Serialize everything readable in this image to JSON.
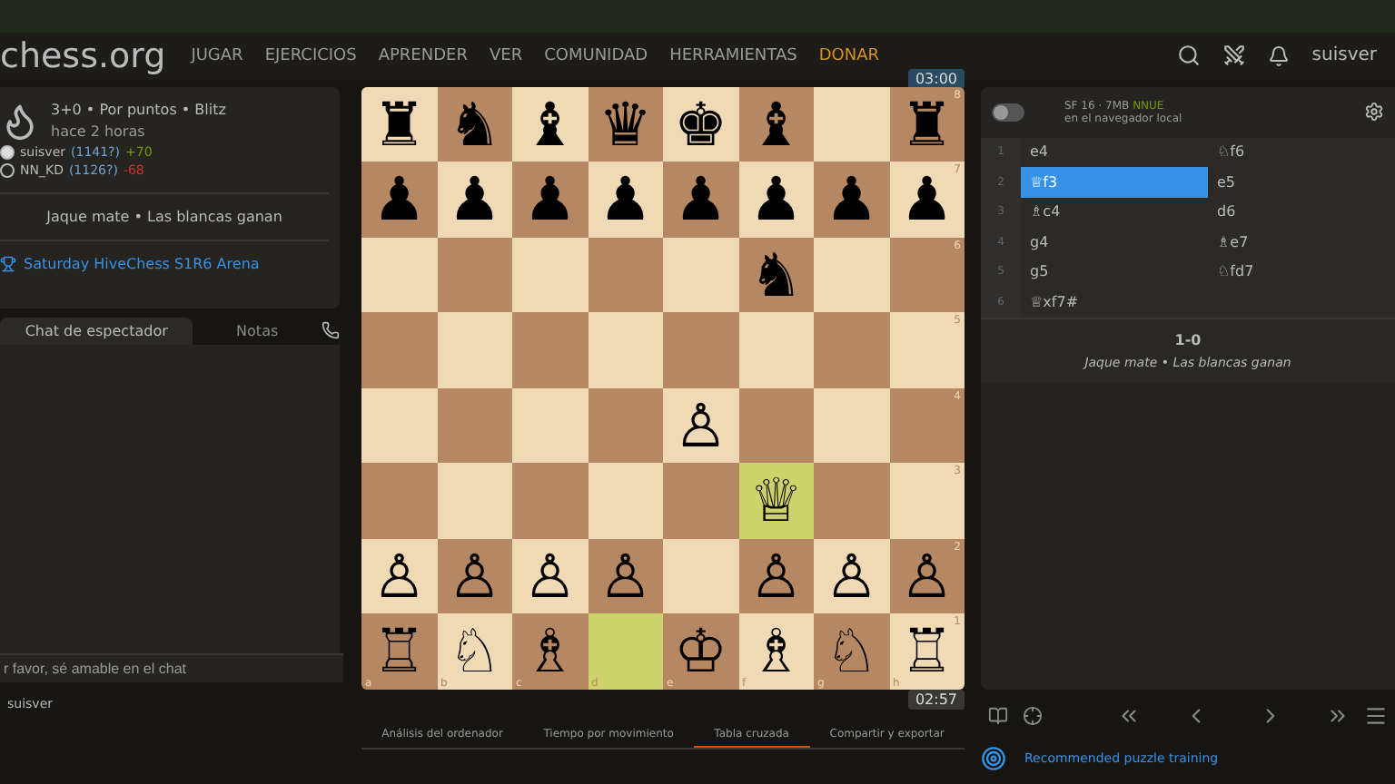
{
  "nav": {
    "logo": "chess.org",
    "links": [
      {
        "label": "JUGAR",
        "kind": "normal"
      },
      {
        "label": "EJERCICIOS",
        "kind": "normal"
      },
      {
        "label": "APRENDER",
        "kind": "normal"
      },
      {
        "label": "VER",
        "kind": "normal"
      },
      {
        "label": "COMUNIDAD",
        "kind": "normal"
      },
      {
        "label": "HERRAMIENTAS",
        "kind": "normal"
      },
      {
        "label": "DONAR",
        "kind": "donate"
      }
    ],
    "user": "suisver"
  },
  "game": {
    "title": "3+0 • Por puntos • Blitz",
    "time": "hace 2 horas",
    "players": [
      {
        "kind": "white",
        "name": "suisver",
        "rating": "(1141?)",
        "diff": "+70",
        "gain": true
      },
      {
        "kind": "black",
        "name": "NN_KD",
        "rating": "(1126?)",
        "diff": "-68",
        "gain": false
      }
    ],
    "status": "Jaque mate • Las blancas ganan",
    "tournament": "Saturday HiveChess S1R6 Arena"
  },
  "chat": {
    "tabs": [
      {
        "label": "Chat de espectador",
        "selected": true
      },
      {
        "label": "Notas",
        "selected": false
      }
    ],
    "placeholder": "r favor, sé amable en el chat",
    "user": "suisver"
  },
  "board": {
    "clock_top": "03:00",
    "clock_bottom": "02:57",
    "rank_labels": [
      "8",
      "7",
      "6",
      "5",
      "4",
      "3",
      "2",
      "1"
    ],
    "files": [
      "a",
      "b",
      "c",
      "d",
      "e",
      "f",
      "g",
      "h"
    ],
    "ranks": [
      [
        {
          "piece": "♜",
          "highlighted": false
        },
        {
          "piece": "♞",
          "highlighted": false
        },
        {
          "piece": "♝",
          "highlighted": false
        },
        {
          "piece": "♛",
          "highlighted": false
        },
        {
          "piece": "♚",
          "highlighted": false
        },
        {
          "piece": "♝",
          "highlighted": false
        },
        {
          "highlighted": false
        },
        {
          "piece": "♜",
          "highlighted": false
        }
      ],
      [
        {
          "piece": "♟",
          "highlighted": false
        },
        {
          "piece": "♟",
          "highlighted": false
        },
        {
          "piece": "♟",
          "highlighted": false
        },
        {
          "piece": "♟",
          "highlighted": false
        },
        {
          "piece": "♟",
          "highlighted": false
        },
        {
          "piece": "♟",
          "highlighted": false
        },
        {
          "piece": "♟",
          "highlighted": false
        },
        {
          "piece": "♟",
          "highlighted": false
        }
      ],
      [
        {
          "highlighted": false
        },
        {
          "highlighted": false
        },
        {
          "highlighted": false
        },
        {
          "highlighted": false
        },
        {
          "highlighted": false
        },
        {
          "piece": "♞",
          "highlighted": false
        },
        {
          "highlighted": false
        },
        {
          "highlighted": false
        }
      ],
      [
        {
          "highlighted": false
        },
        {
          "highlighted": false
        },
        {
          "highlighted": false
        },
        {
          "highlighted": false
        },
        {
          "highlighted": false
        },
        {
          "highlighted": false
        },
        {
          "highlighted": false
        },
        {
          "highlighted": false
        }
      ],
      [
        {
          "highlighted": false
        },
        {
          "highlighted": false
        },
        {
          "highlighted": false
        },
        {
          "highlighted": false
        },
        {
          "piece": "♙",
          "highlighted": false
        },
        {
          "highlighted": false
        },
        {
          "highlighted": false
        },
        {
          "highlighted": false
        }
      ],
      [
        {
          "highlighted": false
        },
        {
          "highlighted": false
        },
        {
          "highlighted": false
        },
        {
          "highlighted": false
        },
        {
          "highlighted": false
        },
        {
          "piece": "♕",
          "highlighted": true
        },
        {
          "highlighted": false
        },
        {
          "highlighted": false
        }
      ],
      [
        {
          "piece": "♙",
          "highlighted": false
        },
        {
          "piece": "♙",
          "highlighted": false
        },
        {
          "piece": "♙",
          "highlighted": false
        },
        {
          "piece": "♙",
          "highlighted": false
        },
        {
          "highlighted": false
        },
        {
          "piece": "♙",
          "highlighted": false
        },
        {
          "piece": "♙",
          "highlighted": false
        },
        {
          "piece": "♙",
          "highlighted": false
        }
      ],
      [
        {
          "piece": "♖",
          "highlighted": false
        },
        {
          "piece": "♘",
          "highlighted": false
        },
        {
          "piece": "♗",
          "highlighted": false
        },
        {
          "highlighted": true
        },
        {
          "piece": "♔",
          "highlighted": false
        },
        {
          "piece": "♗",
          "highlighted": false
        },
        {
          "piece": "♘",
          "highlighted": false
        },
        {
          "piece": "♖",
          "highlighted": false
        }
      ]
    ]
  },
  "engine": {
    "on": false,
    "name": "SF 16 · 7MB",
    "tag": "NNUE",
    "location": "en el navegador local",
    "moves": [
      {
        "number": "1",
        "white": {
          "san": "e4",
          "selected": false
        },
        "black": {
          "san": "♘f6",
          "selected": false
        }
      },
      {
        "number": "2",
        "white": {
          "san": "♕f3",
          "selected": true
        },
        "black": {
          "san": "e5",
          "selected": false
        }
      },
      {
        "number": "3",
        "white": {
          "san": "♗c4",
          "selected": false
        },
        "black": {
          "san": "d6",
          "selected": false
        }
      },
      {
        "number": "4",
        "white": {
          "san": "g4",
          "selected": false
        },
        "black": {
          "san": "♗e7",
          "selected": false
        }
      },
      {
        "number": "5",
        "white": {
          "san": "g5",
          "selected": false
        },
        "black": {
          "san": "♘fd7",
          "selected": false
        }
      },
      {
        "number": "6",
        "white": {
          "san": "♕xf7#",
          "selected": false
        }
      }
    ],
    "result": "1-0",
    "result_text": "Jaque mate • Las blancas ganan"
  },
  "analysis_tabs": [
    {
      "label": "Análisis del ordenador",
      "selected": false
    },
    {
      "label": "Tiempo por movimiento",
      "selected": false
    },
    {
      "label": "Tabla cruzada",
      "selected": true
    },
    {
      "label": "Compartir y exportar",
      "selected": false
    }
  ],
  "puzzle_link": "Recommended puzzle training"
}
